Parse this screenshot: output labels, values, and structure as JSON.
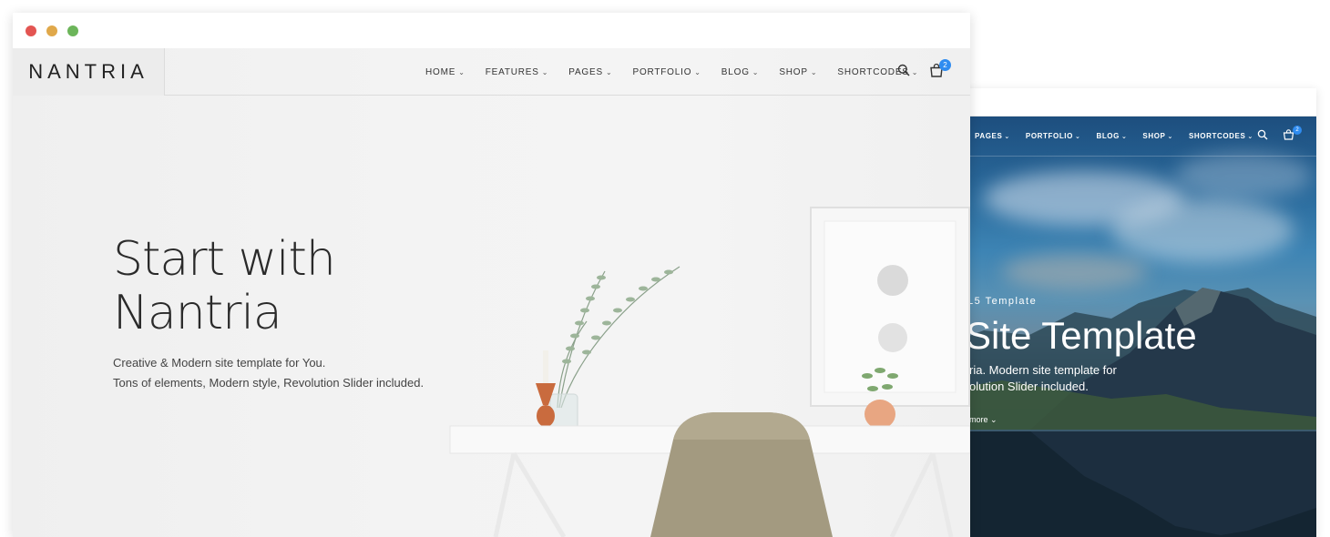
{
  "front": {
    "logo": "NANTRIA",
    "nav": [
      {
        "label": "HOME"
      },
      {
        "label": "FEATURES"
      },
      {
        "label": "PAGES"
      },
      {
        "label": "PORTFOLIO"
      },
      {
        "label": "BLOG"
      },
      {
        "label": "SHOP"
      },
      {
        "label": "SHORTCODES"
      }
    ],
    "cart_count": "2",
    "hero": {
      "title_line1": "Start with",
      "title_line2": "Nantria",
      "desc_line1": "Creative & Modern site template for You.",
      "desc_line2": "Tons of elements, Modern style, Revolution Slider included."
    }
  },
  "back": {
    "nav": [
      {
        "label": "PAGES"
      },
      {
        "label": "PORTFOLIO"
      },
      {
        "label": "BLOG"
      },
      {
        "label": "SHOP"
      },
      {
        "label": "SHORTCODES"
      }
    ],
    "cart_count": "2",
    "hero": {
      "subtitle": "L5 Template",
      "title": "Site Template",
      "desc_line1": "ria. Modern site template for",
      "desc_line2": "olution Slider included.",
      "more": "more"
    }
  },
  "colors": {
    "window_dot_red": "#e35552",
    "window_dot_yellow": "#e0a84a",
    "window_dot_green": "#6cb55a",
    "badge_blue": "#2f8cf0"
  }
}
